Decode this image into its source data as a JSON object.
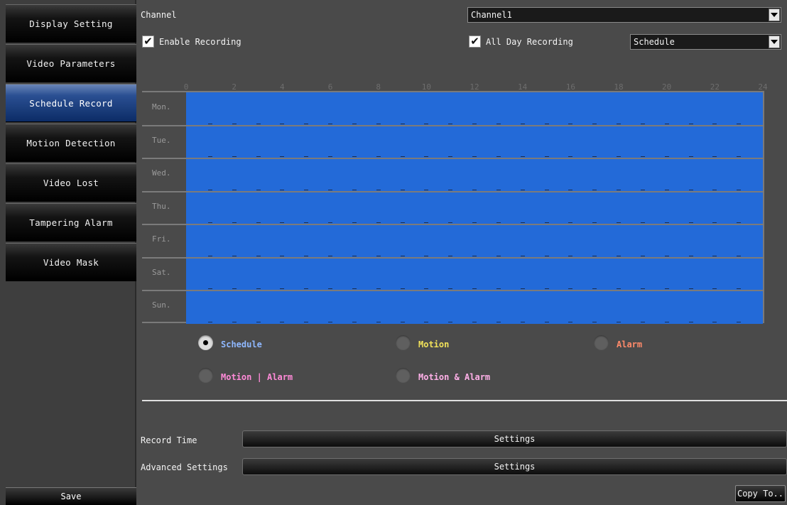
{
  "sidebar": {
    "items": [
      {
        "label": "Display Setting"
      },
      {
        "label": "Video Parameters"
      },
      {
        "label": "Schedule Record"
      },
      {
        "label": "Motion Detection"
      },
      {
        "label": "Video Lost"
      },
      {
        "label": "Tampering Alarm"
      },
      {
        "label": "Video Mask"
      }
    ],
    "active": "Schedule Record",
    "save_label": "Save"
  },
  "header": {
    "channel_label": "Channel",
    "channel_value": "Channel1",
    "enable_recording": {
      "label": "Enable Recording",
      "checked": true
    },
    "all_day_recording": {
      "label": "All Day Recording",
      "checked": true
    },
    "mode_value": "Schedule"
  },
  "schedule": {
    "hours": [
      "0",
      "2",
      "4",
      "6",
      "8",
      "10",
      "12",
      "14",
      "16",
      "18",
      "20",
      "22",
      "24"
    ],
    "days": [
      "Mon.",
      "Tue.",
      "Wed.",
      "Thu.",
      "Fri.",
      "Sat.",
      "Sun."
    ],
    "fill_color": "#236ad8"
  },
  "legend": {
    "items": [
      {
        "label": "Schedule",
        "color": "#8fb8ff",
        "selected": true
      },
      {
        "label": "Motion",
        "color": "#f2e25a",
        "selected": false
      },
      {
        "label": "Alarm",
        "color": "#ff8a6a",
        "selected": false
      },
      {
        "label": "Motion | Alarm",
        "color": "#ff8ad8",
        "selected": false
      },
      {
        "label": "Motion & Alarm",
        "color": "#ffb0e8",
        "selected": false
      }
    ]
  },
  "settings": {
    "record_time_label": "Record Time",
    "record_time_button": "Settings",
    "advanced_label": "Advanced Settings",
    "advanced_button": "Settings",
    "copy_label": "Copy To.."
  }
}
